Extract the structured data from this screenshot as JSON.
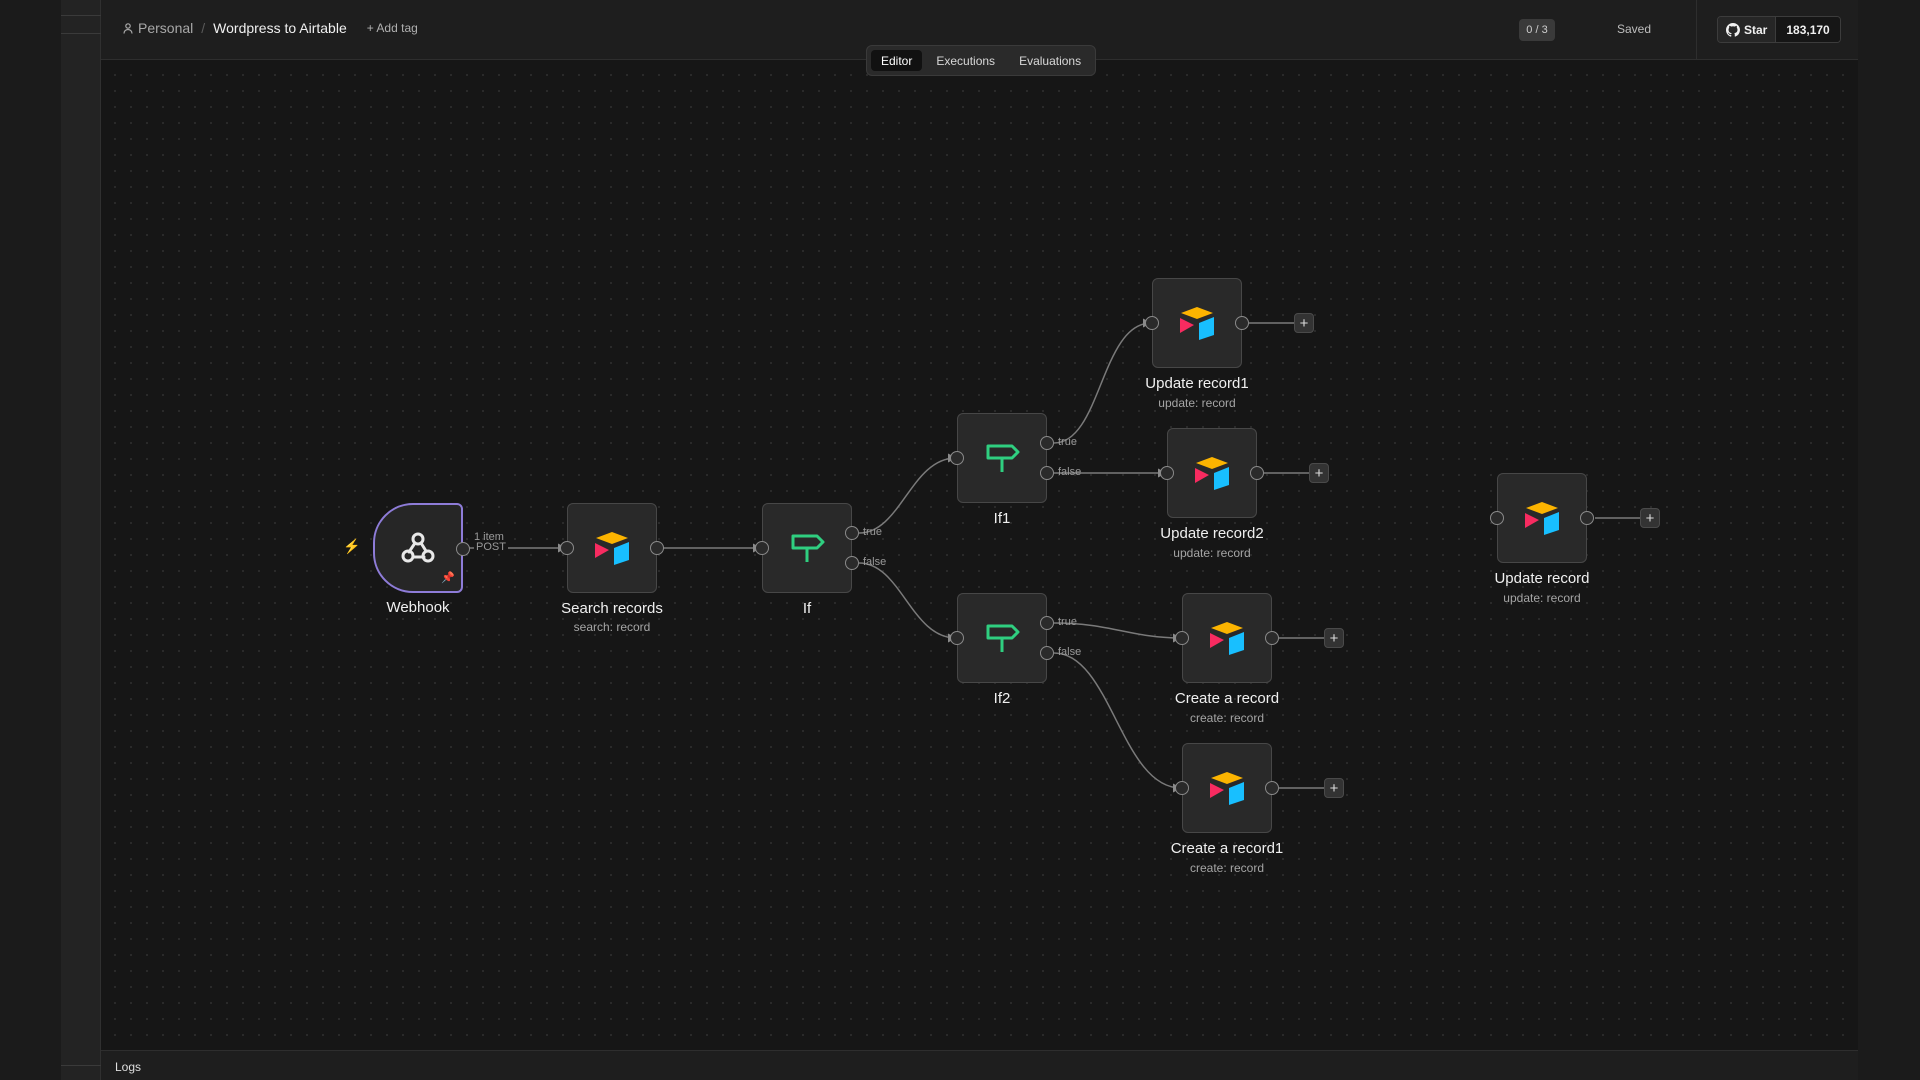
{
  "header": {
    "project": "Personal",
    "separator": "/",
    "workflow_name": "Wordpress to Airtable",
    "add_tag": "+ Add tag",
    "eval_counter": "0 / 3",
    "save_status": "Saved",
    "github": {
      "star_label": "Star",
      "star_count": "183,170"
    }
  },
  "tabs": [
    {
      "label": "Editor",
      "active": true
    },
    {
      "label": "Executions",
      "active": false
    },
    {
      "label": "Evaluations",
      "active": false
    }
  ],
  "nodes": {
    "webhook": {
      "name": "Webhook",
      "subtitle": "",
      "icon": "webhook-icon"
    },
    "search_records": {
      "name": "Search records",
      "subtitle": "search: record",
      "icon": "airtable-icon"
    },
    "if": {
      "name": "If",
      "subtitle": "",
      "icon": "if-signpost-icon"
    },
    "if1": {
      "name": "If1",
      "subtitle": "",
      "icon": "if-signpost-icon"
    },
    "if2": {
      "name": "If2",
      "subtitle": "",
      "icon": "if-signpost-icon"
    },
    "update_record1": {
      "name": "Update record1",
      "subtitle": "update: record",
      "icon": "airtable-icon"
    },
    "update_record2": {
      "name": "Update record2",
      "subtitle": "update: record",
      "icon": "airtable-icon"
    },
    "create_record": {
      "name": "Create a record",
      "subtitle": "create: record",
      "icon": "airtable-icon"
    },
    "create_record1": {
      "name": "Create a record1",
      "subtitle": "create: record",
      "icon": "airtable-icon"
    },
    "update_record": {
      "name": "Update record",
      "subtitle": "update: record",
      "icon": "airtable-icon"
    }
  },
  "connections": {
    "webhook_output_label": "POST",
    "webhook_items_label": "1 item",
    "true_label": "true",
    "false_label": "false",
    "add_symbol": "+"
  },
  "footer": {
    "logs_label": "Logs"
  },
  "colors": {
    "trigger_border": "#8e7cd8",
    "if_icon": "#2fcf80",
    "airtable_yellow": "#fcb400",
    "airtable_blue": "#18bfff",
    "airtable_red": "#f82b60",
    "trigger_bolt": "#ff5a4f"
  }
}
